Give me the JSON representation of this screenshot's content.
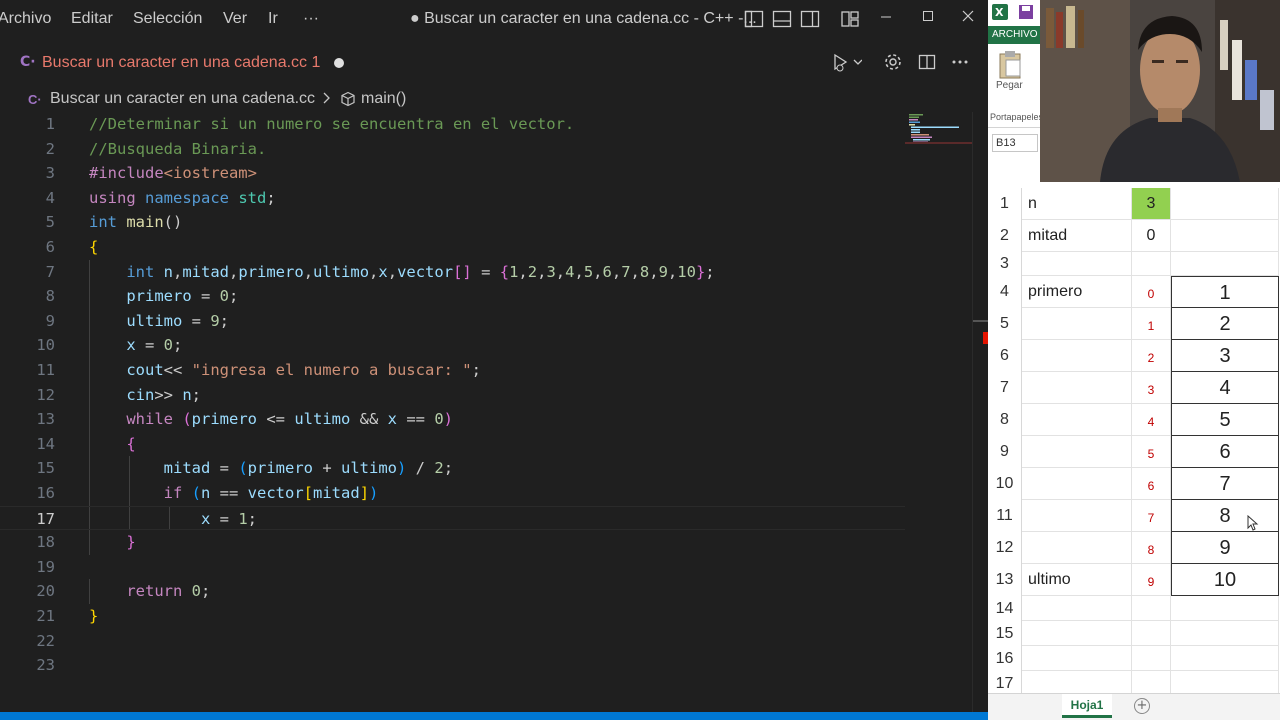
{
  "vscode": {
    "menu": [
      "Archivo",
      "Editar",
      "Selección",
      "Ver",
      "Ir",
      "···"
    ],
    "window_title": "● Buscar un caracter en una cadena.cc - C++ -...",
    "tab": {
      "label": "Buscar un caracter en una cadena.cc",
      "problems_count": "1"
    },
    "breadcrumb": {
      "file": "Buscar un caracter en una cadena.cc",
      "symbol": "main()"
    },
    "code": [
      {
        "n": "1",
        "tokens": [
          [
            "//Determinar si un numero se encuentra en el vector.",
            "#6a9955"
          ]
        ]
      },
      {
        "n": "2",
        "tokens": [
          [
            "//Busqueda Binaria.",
            "#6a9955"
          ]
        ]
      },
      {
        "n": "3",
        "tokens": [
          [
            "#include",
            "#c586c0"
          ],
          [
            "<iostream>",
            "#ce9178"
          ]
        ]
      },
      {
        "n": "4",
        "tokens": [
          [
            "using ",
            "#c586c0"
          ],
          [
            "namespace ",
            "#569cd6"
          ],
          [
            "std",
            "#4ec9b0"
          ],
          [
            ";",
            "#cccccc"
          ]
        ]
      },
      {
        "n": "5",
        "tokens": [
          [
            "int ",
            "#569cd6"
          ],
          [
            "main",
            "#dcdcaa"
          ],
          [
            "()",
            "#cccccc"
          ]
        ]
      },
      {
        "n": "6",
        "tokens": [
          [
            "{",
            "#ffd700"
          ]
        ]
      },
      {
        "n": "7",
        "tokens": [
          [
            "    ",
            "#cccccc"
          ],
          [
            "int ",
            "#569cd6"
          ],
          [
            "n",
            "#9cdcfe"
          ],
          [
            ",",
            "#cccccc"
          ],
          [
            "mitad",
            "#9cdcfe"
          ],
          [
            ",",
            "#cccccc"
          ],
          [
            "primero",
            "#9cdcfe"
          ],
          [
            ",",
            "#cccccc"
          ],
          [
            "ultimo",
            "#9cdcfe"
          ],
          [
            ",",
            "#cccccc"
          ],
          [
            "x",
            "#9cdcfe"
          ],
          [
            ",",
            "#cccccc"
          ],
          [
            "vector",
            "#9cdcfe"
          ],
          [
            "[]",
            "#da70d6"
          ],
          [
            " = ",
            "#cccccc"
          ],
          [
            "{",
            "#da70d6"
          ],
          [
            "1",
            "#b5cea8"
          ],
          [
            ",",
            "#cccccc"
          ],
          [
            "2",
            "#b5cea8"
          ],
          [
            ",",
            "#cccccc"
          ],
          [
            "3",
            "#b5cea8"
          ],
          [
            ",",
            "#cccccc"
          ],
          [
            "4",
            "#b5cea8"
          ],
          [
            ",",
            "#cccccc"
          ],
          [
            "5",
            "#b5cea8"
          ],
          [
            ",",
            "#cccccc"
          ],
          [
            "6",
            "#b5cea8"
          ],
          [
            ",",
            "#cccccc"
          ],
          [
            "7",
            "#b5cea8"
          ],
          [
            ",",
            "#cccccc"
          ],
          [
            "8",
            "#b5cea8"
          ],
          [
            ",",
            "#cccccc"
          ],
          [
            "9",
            "#b5cea8"
          ],
          [
            ",",
            "#cccccc"
          ],
          [
            "10",
            "#b5cea8"
          ],
          [
            "}",
            "#da70d6"
          ],
          [
            ";",
            "#cccccc"
          ]
        ]
      },
      {
        "n": "8",
        "tokens": [
          [
            "    ",
            "#cccccc"
          ],
          [
            "primero",
            "#9cdcfe"
          ],
          [
            " = ",
            "#cccccc"
          ],
          [
            "0",
            "#b5cea8"
          ],
          [
            ";",
            "#cccccc"
          ]
        ]
      },
      {
        "n": "9",
        "tokens": [
          [
            "    ",
            "#cccccc"
          ],
          [
            "ultimo",
            "#9cdcfe"
          ],
          [
            " = ",
            "#cccccc"
          ],
          [
            "9",
            "#b5cea8"
          ],
          [
            ";",
            "#cccccc"
          ]
        ]
      },
      {
        "n": "10",
        "tokens": [
          [
            "    ",
            "#cccccc"
          ],
          [
            "x",
            "#9cdcfe"
          ],
          [
            " = ",
            "#cccccc"
          ],
          [
            "0",
            "#b5cea8"
          ],
          [
            ";",
            "#cccccc"
          ]
        ]
      },
      {
        "n": "11",
        "tokens": [
          [
            "    ",
            "#cccccc"
          ],
          [
            "cout",
            "#9cdcfe"
          ],
          [
            "<< ",
            "#cccccc"
          ],
          [
            "\"ingresa el numero a buscar: \"",
            "#ce9178"
          ],
          [
            ";",
            "#cccccc"
          ]
        ]
      },
      {
        "n": "12",
        "tokens": [
          [
            "    ",
            "#cccccc"
          ],
          [
            "cin",
            "#9cdcfe"
          ],
          [
            ">> ",
            "#cccccc"
          ],
          [
            "n",
            "#9cdcfe"
          ],
          [
            ";",
            "#cccccc"
          ]
        ]
      },
      {
        "n": "13",
        "tokens": [
          [
            "    ",
            "#cccccc"
          ],
          [
            "while ",
            "#c586c0"
          ],
          [
            "(",
            "#da70d6"
          ],
          [
            "primero",
            "#9cdcfe"
          ],
          [
            " <= ",
            "#cccccc"
          ],
          [
            "ultimo",
            "#9cdcfe"
          ],
          [
            " && ",
            "#cccccc"
          ],
          [
            "x",
            "#9cdcfe"
          ],
          [
            " == ",
            "#cccccc"
          ],
          [
            "0",
            "#b5cea8"
          ],
          [
            ")",
            "#da70d6"
          ]
        ]
      },
      {
        "n": "14",
        "tokens": [
          [
            "    ",
            "#cccccc"
          ],
          [
            "{",
            "#da70d6"
          ]
        ]
      },
      {
        "n": "15",
        "tokens": [
          [
            "        ",
            "#cccccc"
          ],
          [
            "mitad",
            "#9cdcfe"
          ],
          [
            " = ",
            "#cccccc"
          ],
          [
            "(",
            "#179fff"
          ],
          [
            "primero",
            "#9cdcfe"
          ],
          [
            " + ",
            "#cccccc"
          ],
          [
            "ultimo",
            "#9cdcfe"
          ],
          [
            ")",
            "#179fff"
          ],
          [
            " / ",
            "#cccccc"
          ],
          [
            "2",
            "#b5cea8"
          ],
          [
            ";",
            "#cccccc"
          ]
        ]
      },
      {
        "n": "16",
        "tokens": [
          [
            "        ",
            "#cccccc"
          ],
          [
            "if ",
            "#c586c0"
          ],
          [
            "(",
            "#179fff"
          ],
          [
            "n",
            "#9cdcfe"
          ],
          [
            " == ",
            "#cccccc"
          ],
          [
            "vector",
            "#9cdcfe"
          ],
          [
            "[",
            "#ffd700"
          ],
          [
            "mitad",
            "#9cdcfe"
          ],
          [
            "]",
            "#ffd700"
          ],
          [
            ")",
            "#179fff"
          ]
        ]
      },
      {
        "n": "17",
        "tokens": [
          [
            "            ",
            "#cccccc"
          ],
          [
            "x",
            "#9cdcfe"
          ],
          [
            " = ",
            "#cccccc"
          ],
          [
            "1",
            "#b5cea8"
          ],
          [
            ";",
            "#cccccc"
          ]
        ]
      },
      {
        "n": "18",
        "tokens": [
          [
            "    ",
            "#cccccc"
          ],
          [
            "}",
            "#da70d6"
          ]
        ]
      },
      {
        "n": "19",
        "tokens": []
      },
      {
        "n": "20",
        "tokens": [
          [
            "    ",
            "#cccccc"
          ],
          [
            "return ",
            "#c586c0"
          ],
          [
            "0",
            "#b5cea8"
          ],
          [
            ";",
            "#cccccc"
          ]
        ]
      },
      {
        "n": "21",
        "tokens": [
          [
            "}",
            "#ffd700"
          ]
        ]
      },
      {
        "n": "22",
        "tokens": []
      },
      {
        "n": "23",
        "tokens": []
      }
    ],
    "current_line": "17"
  },
  "excel": {
    "ribbon_tab": "ARCHIVO",
    "paste_label": "Pegar",
    "clipboard_label": "Portapapeles",
    "name_box": "B13",
    "sheet_tab": "Hoja1",
    "rows": [
      {
        "r": "1",
        "a": "n",
        "b": "3",
        "c": "",
        "b_highlight": true
      },
      {
        "r": "2",
        "a": "mitad",
        "b": "0",
        "c": ""
      },
      {
        "r": "3",
        "a": "",
        "b": "",
        "c": ""
      },
      {
        "r": "4",
        "a": "primero",
        "b": "0",
        "c": "1",
        "b_index": true
      },
      {
        "r": "5",
        "a": "",
        "b": "1",
        "c": "2",
        "b_index": true
      },
      {
        "r": "6",
        "a": "",
        "b": "2",
        "c": "3",
        "b_index": true
      },
      {
        "r": "7",
        "a": "",
        "b": "3",
        "c": "4",
        "b_index": true
      },
      {
        "r": "8",
        "a": "",
        "b": "4",
        "c": "5",
        "b_index": true
      },
      {
        "r": "9",
        "a": "",
        "b": "5",
        "c": "6",
        "b_index": true
      },
      {
        "r": "10",
        "a": "",
        "b": "6",
        "c": "7",
        "b_index": true
      },
      {
        "r": "11",
        "a": "",
        "b": "7",
        "c": "8",
        "b_index": true
      },
      {
        "r": "12",
        "a": "",
        "b": "8",
        "c": "9",
        "b_index": true
      },
      {
        "r": "13",
        "a": "ultimo",
        "b": "9",
        "c": "10",
        "b_index": true
      },
      {
        "r": "14",
        "a": "",
        "b": "",
        "c": ""
      },
      {
        "r": "15",
        "a": "",
        "b": "",
        "c": ""
      },
      {
        "r": "16",
        "a": "",
        "b": "",
        "c": ""
      },
      {
        "r": "17",
        "a": "",
        "b": "",
        "c": ""
      }
    ]
  },
  "colors": {
    "excel_green": "#217346",
    "cell_highlight": "#92d050",
    "index_red": "#c00000",
    "tab_modified": "#e8796c",
    "status_blue": "#0078d4"
  }
}
